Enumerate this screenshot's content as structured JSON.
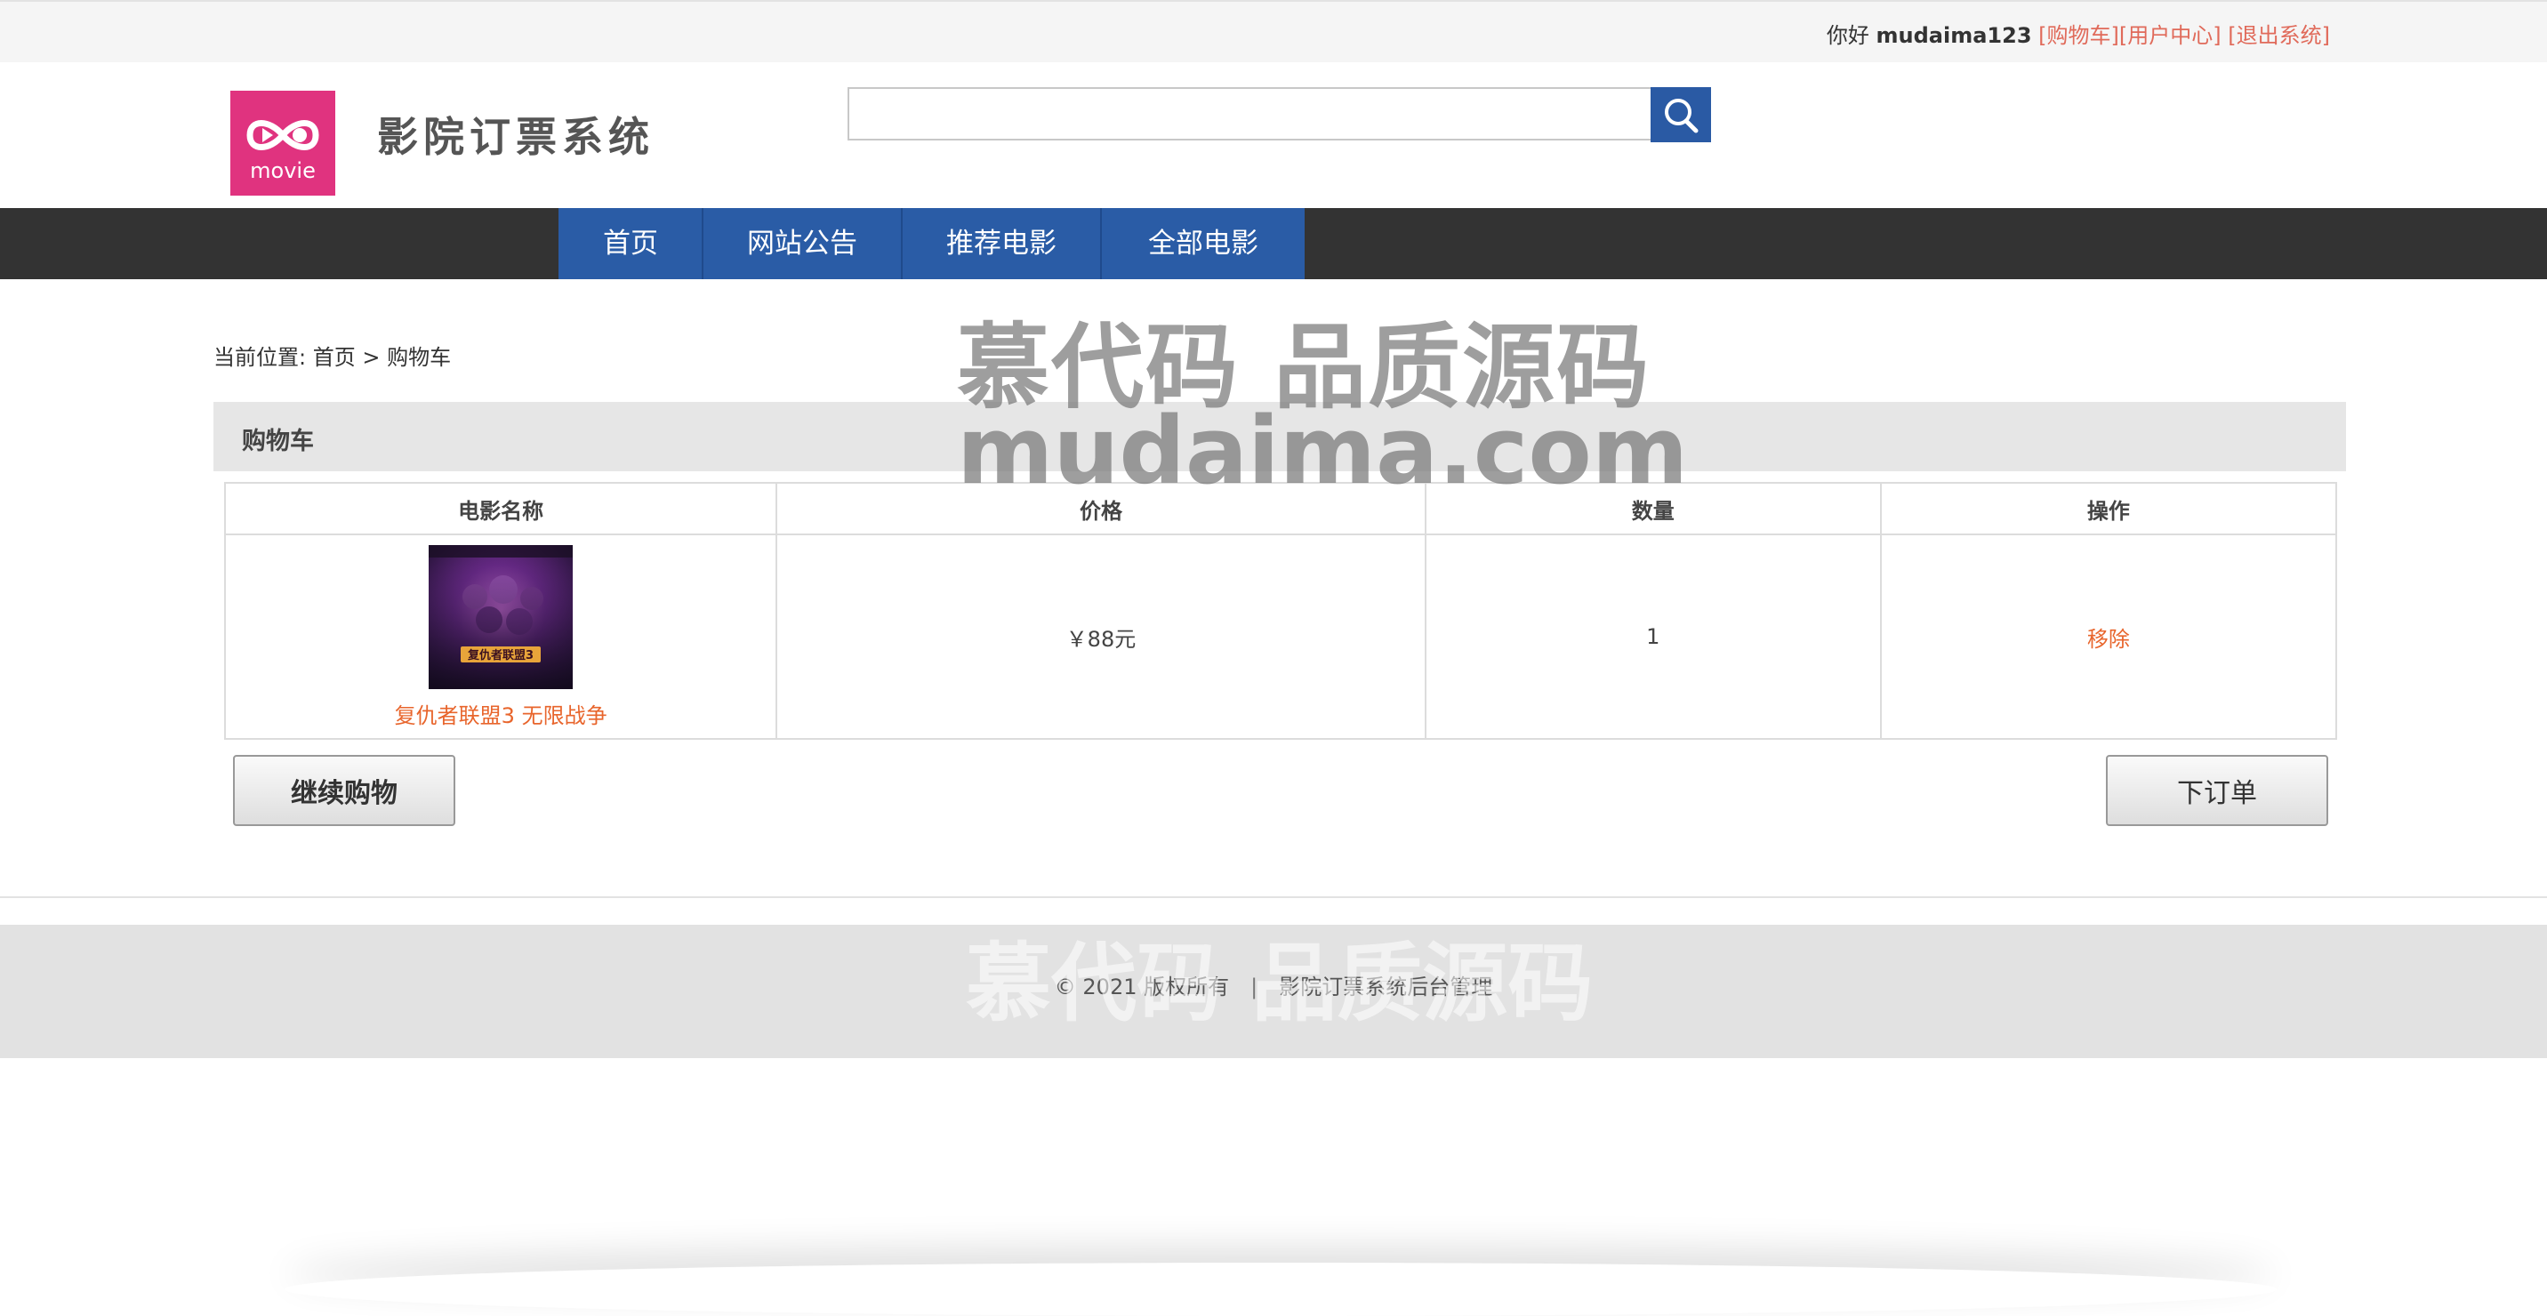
{
  "topbar": {
    "greeting": "你好",
    "username": "mudaima123",
    "links": [
      "[购物车]",
      "[用户中心]",
      "[退出系统]"
    ]
  },
  "header": {
    "logo_text": "movie",
    "site_title": "影院订票系统",
    "search": {
      "value": "",
      "placeholder": ""
    }
  },
  "nav": {
    "items": [
      "首页",
      "网站公告",
      "推荐电影",
      "全部电影"
    ]
  },
  "breadcrumb": {
    "prefix": "当前位置:",
    "home": "首页",
    "sep": ">",
    "current": "购物车"
  },
  "cart": {
    "title": "购物车",
    "columns": [
      "电影名称",
      "价格",
      "数量",
      "操作"
    ],
    "rows": [
      {
        "poster_text": "复仇者联盟3",
        "name": "复仇者联盟3 无限战争",
        "price": "￥88元",
        "quantity": "1",
        "action": "移除"
      }
    ],
    "continue_label": "继续购物",
    "order_label": "下订单"
  },
  "footer": {
    "copyright": "© 2021 版权所有",
    "divider": "|",
    "admin": "影院订票系统后台管理"
  },
  "watermark": {
    "line1": "慕代码 品质源码",
    "line2": "mudaima.com"
  },
  "colors": {
    "nav_active": "#2a5ca6",
    "navbar": "#333333",
    "accent_link": "#e8652c",
    "top_link": "#e06a5a",
    "logo_bg": "#e0337f"
  }
}
